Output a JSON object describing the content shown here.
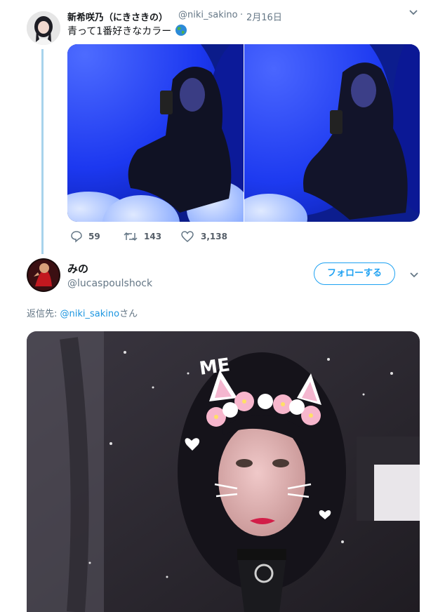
{
  "tweet1": {
    "display_name": "新希咲乃（にきさきの）",
    "handle": "@niki_sakino",
    "separator": "·",
    "date": "2月16日",
    "text": "青って1番好きなカラー",
    "emoji_icon": "globe-icon",
    "stats": {
      "replies": "59",
      "retweets": "143",
      "likes": "3,138"
    }
  },
  "tweet2": {
    "display_name": "みの",
    "handle": "@lucaspoulshock",
    "follow_label": "フォローする",
    "reply_prefix": "返信先: ",
    "reply_to": "@niki_sakino",
    "reply_suffix": "さん",
    "photo_caption": "ME"
  },
  "colors": {
    "accent": "#1da1f2",
    "thread_line": "#a8d3ec",
    "photo_blue": "#1a3cff"
  }
}
